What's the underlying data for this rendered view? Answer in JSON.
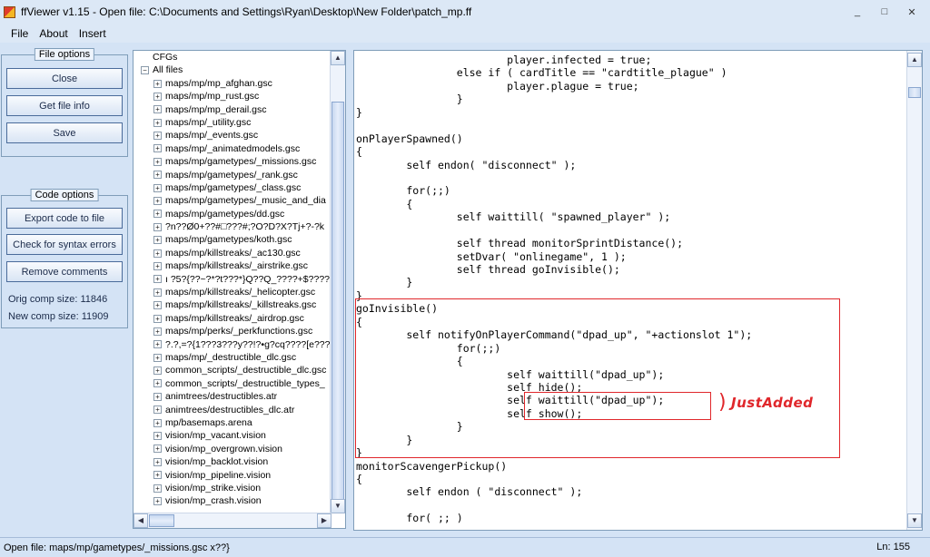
{
  "window": {
    "title": "ffViewer v1.15 - Open file: C:\\Documents and Settings\\Ryan\\Desktop\\New Folder\\patch_mp.ff",
    "min_glyph": "_",
    "max_glyph": "□",
    "close_glyph": "✕"
  },
  "menu": [
    "File",
    "About",
    "Insert"
  ],
  "file_options": {
    "legend": "File options",
    "buttons": [
      "Close",
      "Get file info",
      "Save"
    ]
  },
  "code_options": {
    "legend": "Code options",
    "buttons": [
      "Export code to file",
      "Check for syntax errors",
      "Remove comments"
    ],
    "orig_comp_size": "Orig comp size: 11846",
    "new_comp_size": "New comp size: 11909"
  },
  "tree": {
    "items": [
      {
        "label": "CFGs",
        "level": 0,
        "exp": ""
      },
      {
        "label": "All files",
        "level": 0,
        "exp": "−"
      },
      {
        "label": "maps/mp/mp_afghan.gsc",
        "level": 1,
        "exp": "+"
      },
      {
        "label": "maps/mp/mp_rust.gsc",
        "level": 1,
        "exp": "+"
      },
      {
        "label": "maps/mp/mp_derail.gsc",
        "level": 1,
        "exp": "+"
      },
      {
        "label": "maps/mp/_utility.gsc",
        "level": 1,
        "exp": "+"
      },
      {
        "label": "maps/mp/_events.gsc",
        "level": 1,
        "exp": "+"
      },
      {
        "label": "maps/mp/_animatedmodels.gsc",
        "level": 1,
        "exp": "+"
      },
      {
        "label": "maps/mp/gametypes/_missions.gsc",
        "level": 1,
        "exp": "+"
      },
      {
        "label": "maps/mp/gametypes/_rank.gsc",
        "level": 1,
        "exp": "+"
      },
      {
        "label": "maps/mp/gametypes/_class.gsc",
        "level": 1,
        "exp": "+"
      },
      {
        "label": "maps/mp/gametypes/_music_and_dia",
        "level": 1,
        "exp": "+"
      },
      {
        "label": "maps/mp/gametypes/dd.gsc",
        "level": 1,
        "exp": "+"
      },
      {
        "label": "?n??Ø0+??#□???#;?O?D?X?Tj+?-?k",
        "level": 1,
        "exp": "+"
      },
      {
        "label": "maps/mp/gametypes/koth.gsc",
        "level": 1,
        "exp": "+"
      },
      {
        "label": "maps/mp/killstreaks/_ac130.gsc",
        "level": 1,
        "exp": "+"
      },
      {
        "label": "maps/mp/killstreaks/_airstrike.gsc",
        "level": 1,
        "exp": "+"
      },
      {
        "label": "ı ?5?{??~?*?t???*}Q??Q_????+$????",
        "level": 1,
        "exp": "+"
      },
      {
        "label": "maps/mp/killstreaks/_helicopter.gsc",
        "level": 1,
        "exp": "+"
      },
      {
        "label": "maps/mp/killstreaks/_killstreaks.gsc",
        "level": 1,
        "exp": "+"
      },
      {
        "label": "maps/mp/killstreaks/_airdrop.gsc",
        "level": 1,
        "exp": "+"
      },
      {
        "label": "maps/mp/perks/_perkfunctions.gsc",
        "level": 1,
        "exp": "+"
      },
      {
        "label": "?.?,=?{1???3???y??!?•g?cq????[e???",
        "level": 1,
        "exp": "+"
      },
      {
        "label": "maps/mp/_destructible_dlc.gsc",
        "level": 1,
        "exp": "+"
      },
      {
        "label": "common_scripts/_destructible_dlc.gsc",
        "level": 1,
        "exp": "+"
      },
      {
        "label": "common_scripts/_destructible_types_",
        "level": 1,
        "exp": "+"
      },
      {
        "label": "animtrees/destructibles.atr",
        "level": 1,
        "exp": "+"
      },
      {
        "label": "animtrees/destructibles_dlc.atr",
        "level": 1,
        "exp": "+"
      },
      {
        "label": "mp/basemaps.arena",
        "level": 1,
        "exp": "+"
      },
      {
        "label": "vision/mp_vacant.vision",
        "level": 1,
        "exp": "+"
      },
      {
        "label": "vision/mp_overgrown.vision",
        "level": 1,
        "exp": "+"
      },
      {
        "label": "vision/mp_backlot.vision",
        "level": 1,
        "exp": "+"
      },
      {
        "label": "vision/mp_pipeline.vision",
        "level": 1,
        "exp": "+"
      },
      {
        "label": "vision/mp_strike.vision",
        "level": 1,
        "exp": "+"
      },
      {
        "label": "vision/mp_crash.vision",
        "level": 1,
        "exp": "+"
      }
    ]
  },
  "code": {
    "lines": [
      "                        player.infected = true;",
      "                else if ( cardTitle == \"cardtitle_plague\" )",
      "                        player.plague = true;",
      "                }",
      "}",
      "",
      "onPlayerSpawned()",
      "{",
      "        self endon( \"disconnect\" );",
      "",
      "        for(;;)",
      "        {",
      "                self waittill( \"spawned_player\" );",
      "",
      "                self thread monitorSprintDistance();",
      "                setDvar( \"onlinegame\", 1 );",
      "                self thread goInvisible();",
      "        }",
      "}",
      "goInvisible()",
      "{",
      "        self notifyOnPlayerCommand(\"dpad_up\", \"+actionslot 1\");",
      "                for(;;)",
      "                {",
      "                        self waittill(\"dpad_up\");",
      "                        self hide();",
      "                        self waittill(\"dpad_up\");",
      "                        self show();",
      "                }",
      "        }",
      "}",
      "monitorScavengerPickup()",
      "{",
      "        self endon ( \"disconnect\" );",
      "",
      "        for( ;; )"
    ]
  },
  "annotation": {
    "text": "JustAdded"
  },
  "status": {
    "left": "Open file: maps/mp/gametypes/_missions.gsc  x??}",
    "right": "Ln: 155"
  },
  "colors": {
    "highlight": "#e0272b",
    "window_bg": "#d4e3f5"
  }
}
